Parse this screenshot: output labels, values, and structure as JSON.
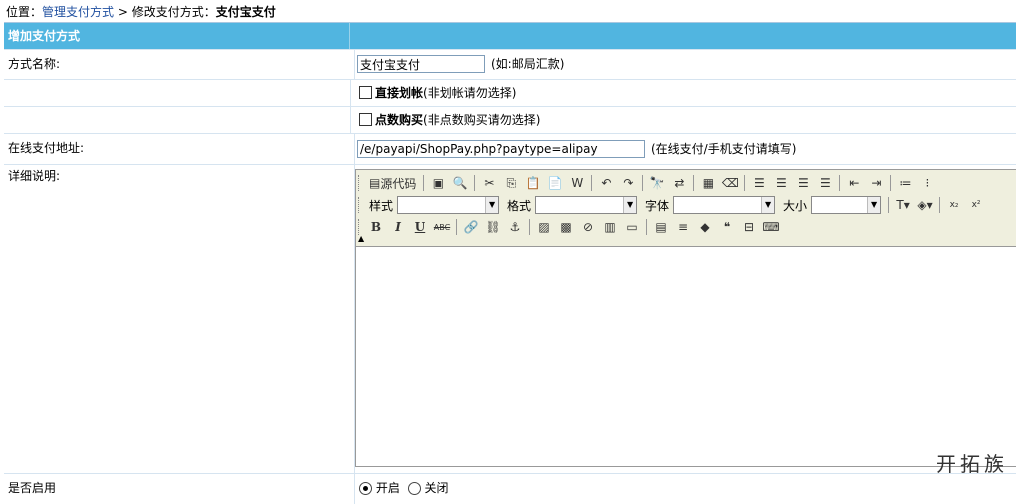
{
  "breadcrumb": {
    "prefix": "位置：",
    "link": "管理支付方式",
    "sep": " > ",
    "middle": "修改支付方式：",
    "current": "支付宝支付"
  },
  "header": {
    "title": "增加支付方式"
  },
  "form": {
    "name_label": "方式名称:",
    "name_value": "支付宝支付",
    "name_hint": "(如:邮局汇款)",
    "direct_label": "直接划帐",
    "direct_hint": "(非划帐请勿选择)",
    "points_label": "点数购买",
    "points_hint": "(非点数购买请勿选择)",
    "url_label": "在线支付地址:",
    "url_value": "/e/payapi/ShopPay.php?paytype=alipay",
    "url_hint": "(在线支付/手机支付请填写)",
    "desc_label": "详细说明:",
    "enable_label": "是否启用",
    "enable_on": "开启",
    "enable_off": "关闭"
  },
  "editor": {
    "source_label": "源代码",
    "style_label": "样式",
    "format_label": "格式",
    "font_label": "字体",
    "size_label": "大小"
  },
  "watermark": "开拓族"
}
